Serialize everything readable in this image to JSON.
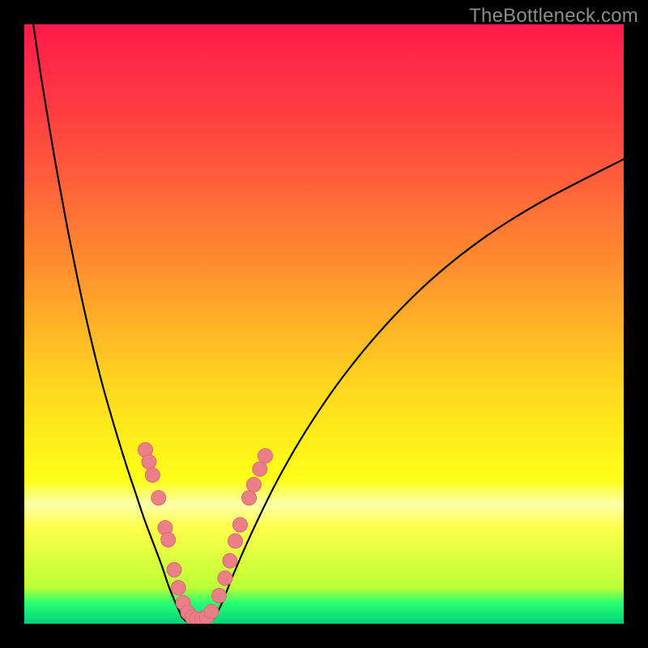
{
  "watermark": "TheBottleneck.com",
  "chart_data": {
    "type": "line",
    "title": "",
    "xlabel": "",
    "ylabel": "",
    "xlim": [
      0,
      100
    ],
    "ylim": [
      0,
      100
    ],
    "grid": false,
    "legend": false,
    "background_gradient_stops": [
      {
        "offset": 0.0,
        "color": "#ff1a4b"
      },
      {
        "offset": 0.18,
        "color": "#ff4640"
      },
      {
        "offset": 0.4,
        "color": "#ff8d2f"
      },
      {
        "offset": 0.6,
        "color": "#ffd61f"
      },
      {
        "offset": 0.76,
        "color": "#feff17"
      },
      {
        "offset": 0.8,
        "color": "#fbffa8"
      },
      {
        "offset": 0.84,
        "color": "#feff4a"
      },
      {
        "offset": 0.94,
        "color": "#bbff35"
      },
      {
        "offset": 0.965,
        "color": "#2aff72"
      },
      {
        "offset": 1.0,
        "color": "#00d47a"
      }
    ],
    "series": [
      {
        "name": "left-branch",
        "x": [
          1.5,
          3,
          5,
          7,
          9,
          11,
          13,
          15,
          17,
          18.5,
          20,
          21.5,
          23,
          24,
          25,
          25.8,
          26.3
        ],
        "y": [
          100,
          90,
          78,
          67,
          57,
          48,
          40,
          33,
          26.5,
          22,
          17.5,
          13.5,
          9.5,
          6.5,
          4,
          2.2,
          1.1
        ]
      },
      {
        "name": "valley",
        "x": [
          26.3,
          27.0,
          28.0,
          29.0,
          30.0,
          31.0,
          31.8
        ],
        "y": [
          1.1,
          0.4,
          0.1,
          0.0,
          0.1,
          0.4,
          1.1
        ]
      },
      {
        "name": "right-branch",
        "x": [
          31.8,
          33,
          35,
          38,
          42,
          47,
          53,
          60,
          68,
          77,
          87,
          100
        ],
        "y": [
          1.1,
          3.5,
          8.5,
          15.3,
          23.5,
          32.2,
          41,
          49.5,
          57.5,
          64.6,
          70.8,
          77.5
        ]
      }
    ],
    "markers": {
      "name": "measured-points",
      "color": "#eb7f88",
      "outline": "#d76a74",
      "radius_px": 9,
      "points": [
        {
          "x": 20.2,
          "y": 29.0
        },
        {
          "x": 20.8,
          "y": 27.0
        },
        {
          "x": 21.4,
          "y": 24.8
        },
        {
          "x": 22.4,
          "y": 21.0
        },
        {
          "x": 23.5,
          "y": 16.0
        },
        {
          "x": 24.0,
          "y": 14.0
        },
        {
          "x": 25.0,
          "y": 9.0
        },
        {
          "x": 25.7,
          "y": 6.0
        },
        {
          "x": 26.5,
          "y": 3.5
        },
        {
          "x": 27.3,
          "y": 1.9
        },
        {
          "x": 28.0,
          "y": 1.1
        },
        {
          "x": 28.8,
          "y": 0.8
        },
        {
          "x": 29.6,
          "y": 0.8
        },
        {
          "x": 30.4,
          "y": 1.1
        },
        {
          "x": 31.2,
          "y": 2.0
        },
        {
          "x": 32.5,
          "y": 4.7
        },
        {
          "x": 33.5,
          "y": 7.6
        },
        {
          "x": 34.3,
          "y": 10.5
        },
        {
          "x": 35.2,
          "y": 13.8
        },
        {
          "x": 36.0,
          "y": 16.5
        },
        {
          "x": 37.5,
          "y": 21.0
        },
        {
          "x": 38.3,
          "y": 23.2
        },
        {
          "x": 39.3,
          "y": 25.8
        },
        {
          "x": 40.2,
          "y": 28.0
        }
      ]
    }
  }
}
